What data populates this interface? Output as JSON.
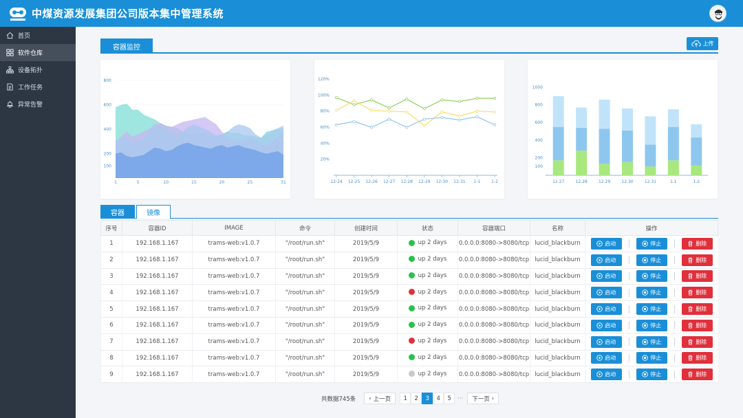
{
  "header": {
    "title": "中煤资源发展集团公司版本集中管理系统"
  },
  "sidebar": {
    "items": [
      {
        "label": "首页",
        "icon": "home-icon",
        "active": false
      },
      {
        "label": "软件仓库",
        "icon": "grid-icon",
        "active": true
      },
      {
        "label": "设备拓扑",
        "icon": "topology-icon",
        "active": false
      },
      {
        "label": "工作任务",
        "icon": "document-icon",
        "active": false
      },
      {
        "label": "异常告警",
        "icon": "alert-icon",
        "active": false
      }
    ]
  },
  "main": {
    "section_tab": "容器监控",
    "upload_label": "上传",
    "table_tabs": [
      "容器",
      "镜像"
    ],
    "columns": [
      "序号",
      "容器ID",
      "IMAGE",
      "命令",
      "创建时间",
      "状态",
      "容器端口",
      "名称",
      "操作"
    ],
    "rows": [
      {
        "no": "1",
        "id": "192.168.1.167",
        "image": "trams-web:v1.0.7",
        "cmd": "\"/root/run.sh\"",
        "created": "2019/5/9",
        "status": "up 2 days",
        "status_color": "#27c24c",
        "port": "0.0.0.0:8080->8080/tcp",
        "name": "lucid_blackburn"
      },
      {
        "no": "2",
        "id": "192.168.1.167",
        "image": "trams-web:v1.0.7",
        "cmd": "\"/root/run.sh\"",
        "created": "2019/5/9",
        "status": "up 2 days",
        "status_color": "#27c24c",
        "port": "0.0.0.0:8080->8080/tcp",
        "name": "lucid_blackburn"
      },
      {
        "no": "3",
        "id": "192.168.1.167",
        "image": "trams-web:v1.0.7",
        "cmd": "\"/root/run.sh\"",
        "created": "2019/5/9",
        "status": "up 2 days",
        "status_color": "#27c24c",
        "port": "0.0.0.0:8080->8080/tcp",
        "name": "lucid_blackburn"
      },
      {
        "no": "4",
        "id": "192.168.1.167",
        "image": "trams-web:v1.0.7",
        "cmd": "\"/root/run.sh\"",
        "created": "2019/5/9",
        "status": "up 2 days",
        "status_color": "#e0303b",
        "port": "0.0.0.0:8080->8080/tcp",
        "name": "lucid_blackburn"
      },
      {
        "no": "5",
        "id": "192.168.1.167",
        "image": "trams-web:v1.0.7",
        "cmd": "\"/root/run.sh\"",
        "created": "2019/5/9",
        "status": "up 2 days",
        "status_color": "#27c24c",
        "port": "0.0.0.0:8080->8080/tcp",
        "name": "lucid_blackburn"
      },
      {
        "no": "6",
        "id": "192.168.1.167",
        "image": "trams-web:v1.0.7",
        "cmd": "\"/root/run.sh\"",
        "created": "2019/5/9",
        "status": "up 2 days",
        "status_color": "#27c24c",
        "port": "0.0.0.0:8080->8080/tcp",
        "name": "lucid_blackburn"
      },
      {
        "no": "7",
        "id": "192.168.1.167",
        "image": "trams-web:v1.0.7",
        "cmd": "\"/root/run.sh\"",
        "created": "2019/5/9",
        "status": "up 2 days",
        "status_color": "#e0303b",
        "port": "0.0.0.0:8080->8080/tcp",
        "name": "lucid_blackburn"
      },
      {
        "no": "8",
        "id": "192.168.1.167",
        "image": "trams-web:v1.0.7",
        "cmd": "\"/root/run.sh\"",
        "created": "2019/5/9",
        "status": "up 2 days",
        "status_color": "#27c24c",
        "port": "0.0.0.0:8080->8080/tcp",
        "name": "lucid_blackburn"
      },
      {
        "no": "9",
        "id": "192.168.1.167",
        "image": "trams-web:v1.0.7",
        "cmd": "\"/root/run.sh\"",
        "created": "2019/5/9",
        "status": "up 2 days",
        "status_color": "#c8c8c8",
        "port": "0.0.0.0:8080->8080/tcp",
        "name": "lucid_blackburn"
      }
    ],
    "actions": {
      "start": "启动",
      "stop": "停止",
      "delete": "删除"
    }
  },
  "pager": {
    "total": "共数据745条",
    "prev": "上一页",
    "next": "下一页",
    "pages": [
      "1",
      "2",
      "3",
      "4",
      "5"
    ],
    "current": "3",
    "ellipsis": "···"
  },
  "chart_data": [
    {
      "type": "area",
      "x": [
        1,
        2,
        3,
        4,
        5,
        6,
        7,
        8,
        9,
        10,
        11,
        12,
        13,
        14,
        15,
        16,
        17,
        18,
        19,
        20,
        21,
        22,
        23,
        24,
        25,
        26,
        27,
        28,
        29,
        30,
        31
      ],
      "xticks": [
        1,
        5,
        10,
        15,
        20,
        25,
        31
      ],
      "yticks": [
        100,
        200,
        400,
        600,
        800
      ],
      "ylim": [
        0,
        800
      ],
      "series": [
        {
          "color": "#7fdcd6",
          "values": [
            580,
            600,
            610,
            560,
            560,
            520,
            500,
            480,
            450,
            430,
            420,
            410,
            380,
            360,
            350,
            370,
            360,
            350,
            340,
            360,
            380,
            370,
            370,
            350,
            350,
            340,
            330,
            380,
            390,
            400,
            410
          ]
        },
        {
          "color": "#c6b6f0",
          "values": [
            300,
            340,
            380,
            340,
            360,
            380,
            400,
            440,
            450,
            430,
            420,
            440,
            460,
            470,
            480,
            490,
            500,
            470,
            440,
            380,
            330,
            310,
            300,
            320,
            330,
            300,
            280,
            260,
            300,
            340,
            380
          ]
        },
        {
          "color": "#a8c8f0",
          "values": [
            300,
            330,
            320,
            290,
            300,
            320,
            380,
            420,
            430,
            400,
            360,
            340,
            380,
            420,
            440,
            420,
            400,
            380,
            350,
            360,
            380,
            420,
            440,
            430,
            410,
            360,
            330,
            360,
            390,
            410,
            430
          ]
        },
        {
          "color": "#7aa6e8",
          "values": [
            200,
            210,
            180,
            170,
            180,
            190,
            220,
            250,
            240,
            220,
            230,
            260,
            280,
            290,
            270,
            260,
            250,
            240,
            260,
            270,
            250,
            260,
            270,
            250,
            240,
            230,
            210,
            200,
            210,
            220,
            190
          ]
        }
      ]
    },
    {
      "type": "line",
      "categories": [
        "12-24",
        "12-25",
        "12-26",
        "12-27",
        "12-28",
        "12-29",
        "12-30",
        "12-31",
        "1-1",
        "1-2"
      ],
      "yticks": [
        "20%",
        "40%",
        "60%",
        "80%",
        "100%",
        "120%"
      ],
      "ylim": [
        0,
        120
      ],
      "series": [
        {
          "color": "#8ccf5a",
          "values": [
            97,
            88,
            94,
            84,
            95,
            83,
            94,
            92,
            96,
            96
          ]
        },
        {
          "color": "#f7dd6a",
          "values": [
            81,
            93,
            81,
            80,
            79,
            62,
            79,
            74,
            80,
            79
          ]
        },
        {
          "color": "#8ec4ea",
          "values": [
            63,
            67,
            60,
            70,
            60,
            70,
            72,
            69,
            73,
            63
          ]
        }
      ]
    },
    {
      "type": "bar",
      "categories": [
        "12.27",
        "12.28",
        "12.29",
        "12.30",
        "12.31",
        "1.1",
        "1.2"
      ],
      "yticks": [
        100,
        200,
        400,
        600,
        800,
        1000
      ],
      "ylim": [
        0,
        1000
      ],
      "series": [
        {
          "color": "#a8e87e",
          "values": [
            170,
            280,
            130,
            150,
            100,
            170,
            110
          ]
        },
        {
          "color": "#8ec7ee",
          "values": [
            380,
            260,
            400,
            360,
            250,
            380,
            320
          ]
        },
        {
          "color": "#c1e3fa",
          "values": [
            350,
            230,
            330,
            250,
            320,
            200,
            150
          ]
        }
      ]
    }
  ]
}
